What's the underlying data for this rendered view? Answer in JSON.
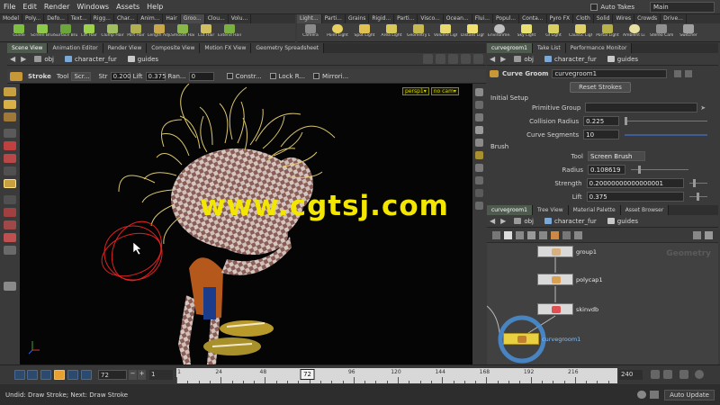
{
  "menubar": {
    "items": [
      "File",
      "Edit",
      "Render",
      "Windows",
      "Assets",
      "Help"
    ],
    "auto_takes_label": "Auto Takes",
    "desktop_value": "Main"
  },
  "shelf_left": {
    "tabs": [
      "Model",
      "Poly...",
      "Defo...",
      "Text...",
      "Rigg...",
      "Char...",
      "Anim...",
      "Hair",
      "Groo...",
      "Clou...",
      "Volu..."
    ],
    "active_tab": 8,
    "tools": [
      "Guide",
      "Screen Brush",
      "Surface Bru...",
      "Lift Hair",
      "Clump Hair",
      "Part Hair",
      "Length Adjust",
      "Smooth Hair",
      "Cut Hair",
      "Extend Hair"
    ]
  },
  "shelf_right": {
    "tabs": [
      "Light...",
      "Parti...",
      "Grains",
      "Rigid...",
      "Parti...",
      "Visco...",
      "Ocean...",
      "Flui...",
      "Popul...",
      "Conta...",
      "Pyro FX",
      "Cloth",
      "Solid",
      "Wires",
      "Crowds",
      "Drive..."
    ],
    "active_tab": 0,
    "tools": [
      "Camera",
      "Point Light",
      "Spot Light",
      "Area Light",
      "Geometry L...",
      "Volume Light",
      "Distant Light",
      "Environme...",
      "Sky Light",
      "GI Light",
      "Caustic Light",
      "Portal Light",
      "Ambient Li...",
      "Stereo Cam...",
      "Switcher"
    ]
  },
  "left_pane": {
    "tabs": [
      "Scene View",
      "Animation Editor",
      "Render View",
      "Composite View",
      "Motion FX View",
      "Geometry Spreadsheet"
    ],
    "active_tab": 0,
    "path": [
      "obj",
      "character_fur",
      "guides"
    ]
  },
  "tool_options": {
    "tool_name": "Stroke",
    "tool_label": "Tool",
    "mode_value": "Scr...",
    "str_label": "Str",
    "str_value": "0.200",
    "lift_label": "Lift",
    "lift_value": "0.375",
    "ran_label": "Ran...",
    "ran_value": "0",
    "constr_label": "Constr...",
    "lockr_label": "Lock R...",
    "mirror_label": "Mirrori..."
  },
  "viewport": {
    "persp_label": "persp1▾",
    "cam_label": "no cam▾",
    "watermark": "www.cgtsj.com"
  },
  "param_pane": {
    "tabs": [
      "curvegroom1",
      "Take List",
      "Performance Monitor"
    ],
    "path": [
      "obj",
      "character_fur",
      "guides"
    ],
    "node_type": "Curve Groom",
    "node_name": "curvegroom1",
    "reset_button": "Reset Strokes",
    "initial_setup": "Initial Setup",
    "primitive_group_label": "Primitive Group",
    "primitive_group_value": "",
    "collision_radius_label": "Collision Radius",
    "collision_radius_value": "0.225",
    "curve_segments_label": "Curve Segments",
    "curve_segments_value": "10",
    "brush": "Brush",
    "tool_label": "Tool",
    "tool_value": "Screen Brush",
    "radius_label": "Radius",
    "radius_value": "0.108619",
    "strength_label": "Strength",
    "strength_value": "0.20000000000000001",
    "lift_label": "Lift",
    "lift_value": "0.375"
  },
  "network_pane": {
    "tabs": [
      "curvegroom1",
      "Tree View",
      "Material Palette",
      "Asset Browser"
    ],
    "path": [
      "obj",
      "character_fur",
      "guides"
    ],
    "watermark": "Geometry",
    "nodes": [
      "group1",
      "polycap1",
      "skinvdb",
      "curvegroom1"
    ]
  },
  "timeline": {
    "current_frame": "72",
    "start_frame": "1",
    "end_frame": "240",
    "ticks": [
      "1",
      "24",
      "48",
      "72",
      "96",
      "120",
      "144",
      "168",
      "192",
      "216"
    ],
    "marker": "72",
    "auto_update": "Auto Update"
  },
  "status": {
    "text": "Undid: Draw Stroke; Next: Draw Stroke"
  },
  "colors": {
    "accent_green": "#9bd24a",
    "viewport_bg": "#050505",
    "watermark": "#f3e600",
    "node_selected_ring": "#4a90d9"
  }
}
